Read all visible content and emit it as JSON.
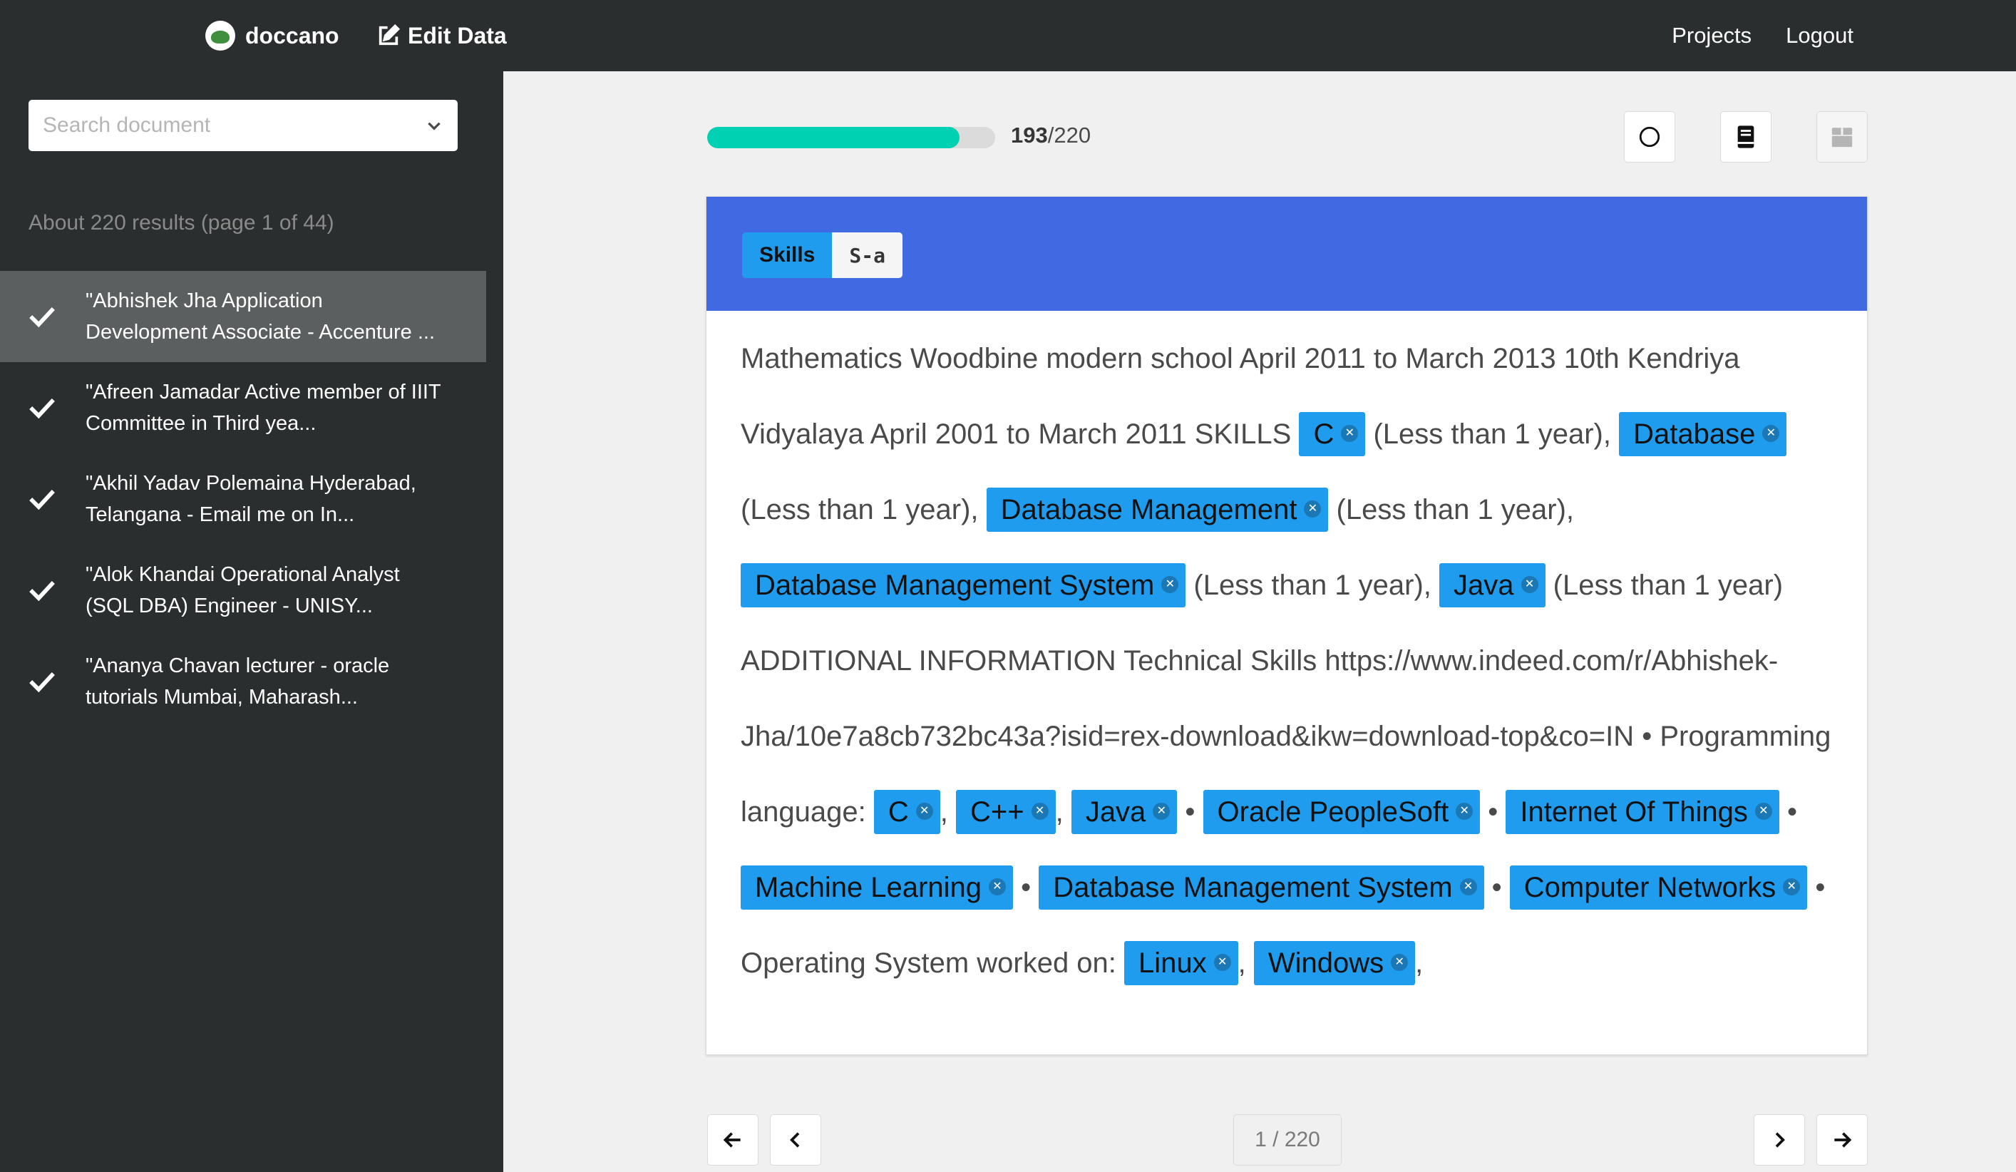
{
  "app": {
    "brand": "doccano",
    "section_title": "Edit Data",
    "nav": [
      "Projects",
      "Logout"
    ]
  },
  "sidebar": {
    "search_placeholder": "Search document",
    "results_info": "About 220 results (page 1 of 44)",
    "documents": [
      {
        "line1": "\"Abhishek Jha Application",
        "line2": "Development Associate - Accenture ...",
        "annotated": true,
        "active": true
      },
      {
        "line1": "\"Afreen Jamadar Active member of IIIT",
        "line2": "Committee in Third yea...",
        "annotated": true,
        "active": false
      },
      {
        "line1": "\"Akhil Yadav Polemaina Hyderabad,",
        "line2": "Telangana - Email me on In...",
        "annotated": true,
        "active": false
      },
      {
        "line1": "\"Alok Khandai Operational Analyst",
        "line2": "(SQL DBA) Engineer - UNISY...",
        "annotated": true,
        "active": false
      },
      {
        "line1": "\"Ananya Chavan lecturer - oracle",
        "line2": "tutorials Mumbai, Maharash...",
        "annotated": true,
        "active": false
      }
    ]
  },
  "progress": {
    "done": "193",
    "total": "/220",
    "fraction": 0.877
  },
  "toolbar": {
    "icons": [
      "circle-icon",
      "guideline-book-icon",
      "approve-box-icon"
    ]
  },
  "labels": [
    {
      "name": "Skills",
      "shortcut": "S-a",
      "color": "#209cee"
    }
  ],
  "header_color": "#4169e1",
  "document_text": [
    {
      "t": "Mathematics Woodbine modern school April 2011 to March 2013 10th Kendriya Vidyalaya April 2001 to March 2011 SKILLS "
    },
    {
      "e": "C"
    },
    {
      "t": " (Less than 1 year), "
    },
    {
      "e": "Database"
    },
    {
      "t": " (Less than 1 year), "
    },
    {
      "e": "Database Management"
    },
    {
      "t": " (Less than 1 year), "
    },
    {
      "e": "Database Management System"
    },
    {
      "t": " (Less than 1 year), "
    },
    {
      "e": "Java"
    },
    {
      "t": " (Less than 1 year) ADDITIONAL INFORMATION Technical Skills https://www.indeed.com/r/Abhishek-Jha/10e7a8cb732bc43a?isid=rex-download&ikw=download-top&co=IN • Programming language: "
    },
    {
      "e": "C"
    },
    {
      "t": ", "
    },
    {
      "e": "C++"
    },
    {
      "t": ", "
    },
    {
      "e": "Java"
    },
    {
      "t": " • "
    },
    {
      "e": "Oracle PeopleSoft"
    },
    {
      "t": " • "
    },
    {
      "e": "Internet Of Things"
    },
    {
      "t": " • "
    },
    {
      "e": "Machine Learning"
    },
    {
      "t": " • "
    },
    {
      "e": "Database Management System"
    },
    {
      "t": " • "
    },
    {
      "e": "Computer Networks"
    },
    {
      "t": " • Operating System worked on: "
    },
    {
      "e": "Linux"
    },
    {
      "t": ", "
    },
    {
      "e": "Windows"
    },
    {
      "t": ","
    }
  ],
  "pagination": {
    "counter": "1 / 220"
  }
}
